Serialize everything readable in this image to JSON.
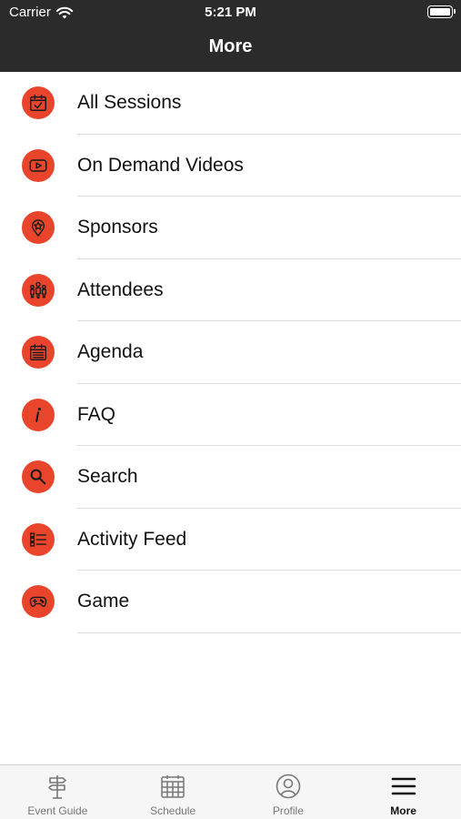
{
  "status_bar": {
    "carrier": "Carrier",
    "time": "5:21 PM"
  },
  "header": {
    "title": "More"
  },
  "accent_color": "#e8452c",
  "menu": [
    {
      "label": "All Sessions",
      "icon": "calendar-check-icon"
    },
    {
      "label": "On Demand Videos",
      "icon": "video-play-icon"
    },
    {
      "label": "Sponsors",
      "icon": "star-badge-icon"
    },
    {
      "label": "Attendees",
      "icon": "people-icon"
    },
    {
      "label": "Agenda",
      "icon": "calendar-list-icon"
    },
    {
      "label": "FAQ",
      "icon": "info-icon"
    },
    {
      "label": "Search",
      "icon": "search-icon"
    },
    {
      "label": "Activity Feed",
      "icon": "list-icon"
    },
    {
      "label": "Game",
      "icon": "gamepad-icon"
    }
  ],
  "tab_bar": [
    {
      "label": "Event Guide",
      "icon": "signpost-icon"
    },
    {
      "label": "Schedule",
      "icon": "calendar-grid-icon"
    },
    {
      "label": "Profile",
      "icon": "user-circle-icon"
    },
    {
      "label": "More",
      "icon": "menu-icon",
      "active": true
    }
  ]
}
